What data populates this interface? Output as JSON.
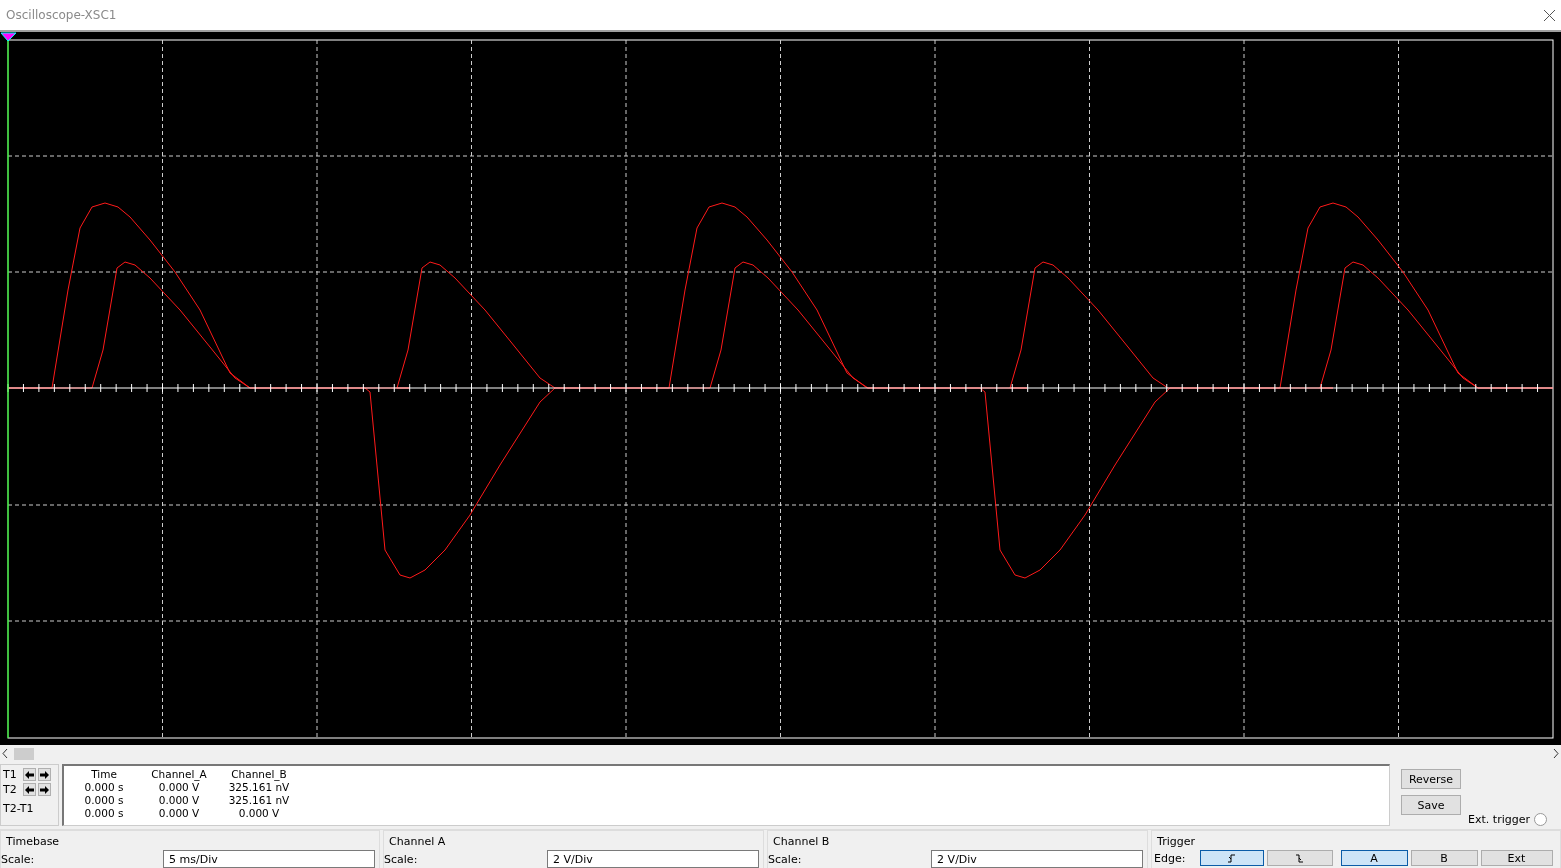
{
  "window": {
    "title": "Oscilloscope-XSC1"
  },
  "cursors": [
    {
      "label": "T1"
    },
    {
      "label": "T2"
    },
    {
      "label": "T2-T1"
    }
  ],
  "readout": {
    "columns": [
      "Time",
      "Channel_A",
      "Channel_B"
    ],
    "rows": [
      [
        "0.000 s",
        "0.000 V",
        "325.161 nV"
      ],
      [
        "0.000 s",
        "0.000 V",
        "325.161 nV"
      ],
      [
        "0.000 s",
        "0.000 V",
        "0.000 V"
      ]
    ]
  },
  "buttons": [
    "Reverse",
    "Save"
  ],
  "ext_trigger": {
    "label": "Ext. trigger",
    "checked": false
  },
  "timebase": {
    "title": "Timebase",
    "label": "Scale:",
    "value": "5 ms/Div"
  },
  "channel_a": {
    "title": "Channel A",
    "label": "Scale:",
    "value": "2  V/Div"
  },
  "channel_b": {
    "title": "Channel B",
    "label": "Scale:",
    "value": "2  V/Div"
  },
  "trigger": {
    "title": "Trigger",
    "label": "Edge:",
    "edges": [
      {
        "kind": "rising",
        "selected": true
      },
      {
        "kind": "falling",
        "selected": false
      }
    ],
    "sources": [
      {
        "label": "A",
        "selected": true
      },
      {
        "label": "B",
        "selected": false
      },
      {
        "label": "Ext",
        "selected": false
      }
    ]
  }
}
